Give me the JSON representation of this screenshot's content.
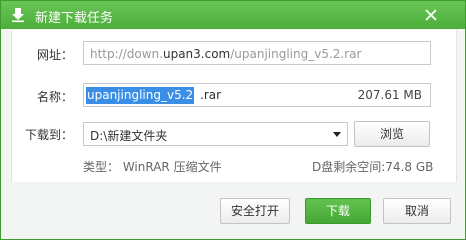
{
  "window": {
    "title": "新建下载任务",
    "accent_color": "#4dae3a"
  },
  "form": {
    "url_label": "网址：",
    "url_prefix": "http://down.",
    "url_host": "upan3.com",
    "url_suffix": "/upanjingling_v5.2.rar",
    "name_label": "名称：",
    "name_selected": "upanjingling_v5.2",
    "name_ext": ".rar",
    "file_size": "207.61 MB",
    "dir_label": "下载到：",
    "dir_value": "D:\\新建文件夹",
    "browse_label": "浏览",
    "type_info": "类型： WinRAR 压缩文件",
    "space_info": "D盘剩余空间:74.8 GB"
  },
  "buttons": {
    "safe_open": "安全打开",
    "download": "下载",
    "cancel": "取消"
  },
  "icons": {
    "title": "download-arrow-icon",
    "close": "close-icon",
    "dropdown": "chevron-down-icon"
  }
}
